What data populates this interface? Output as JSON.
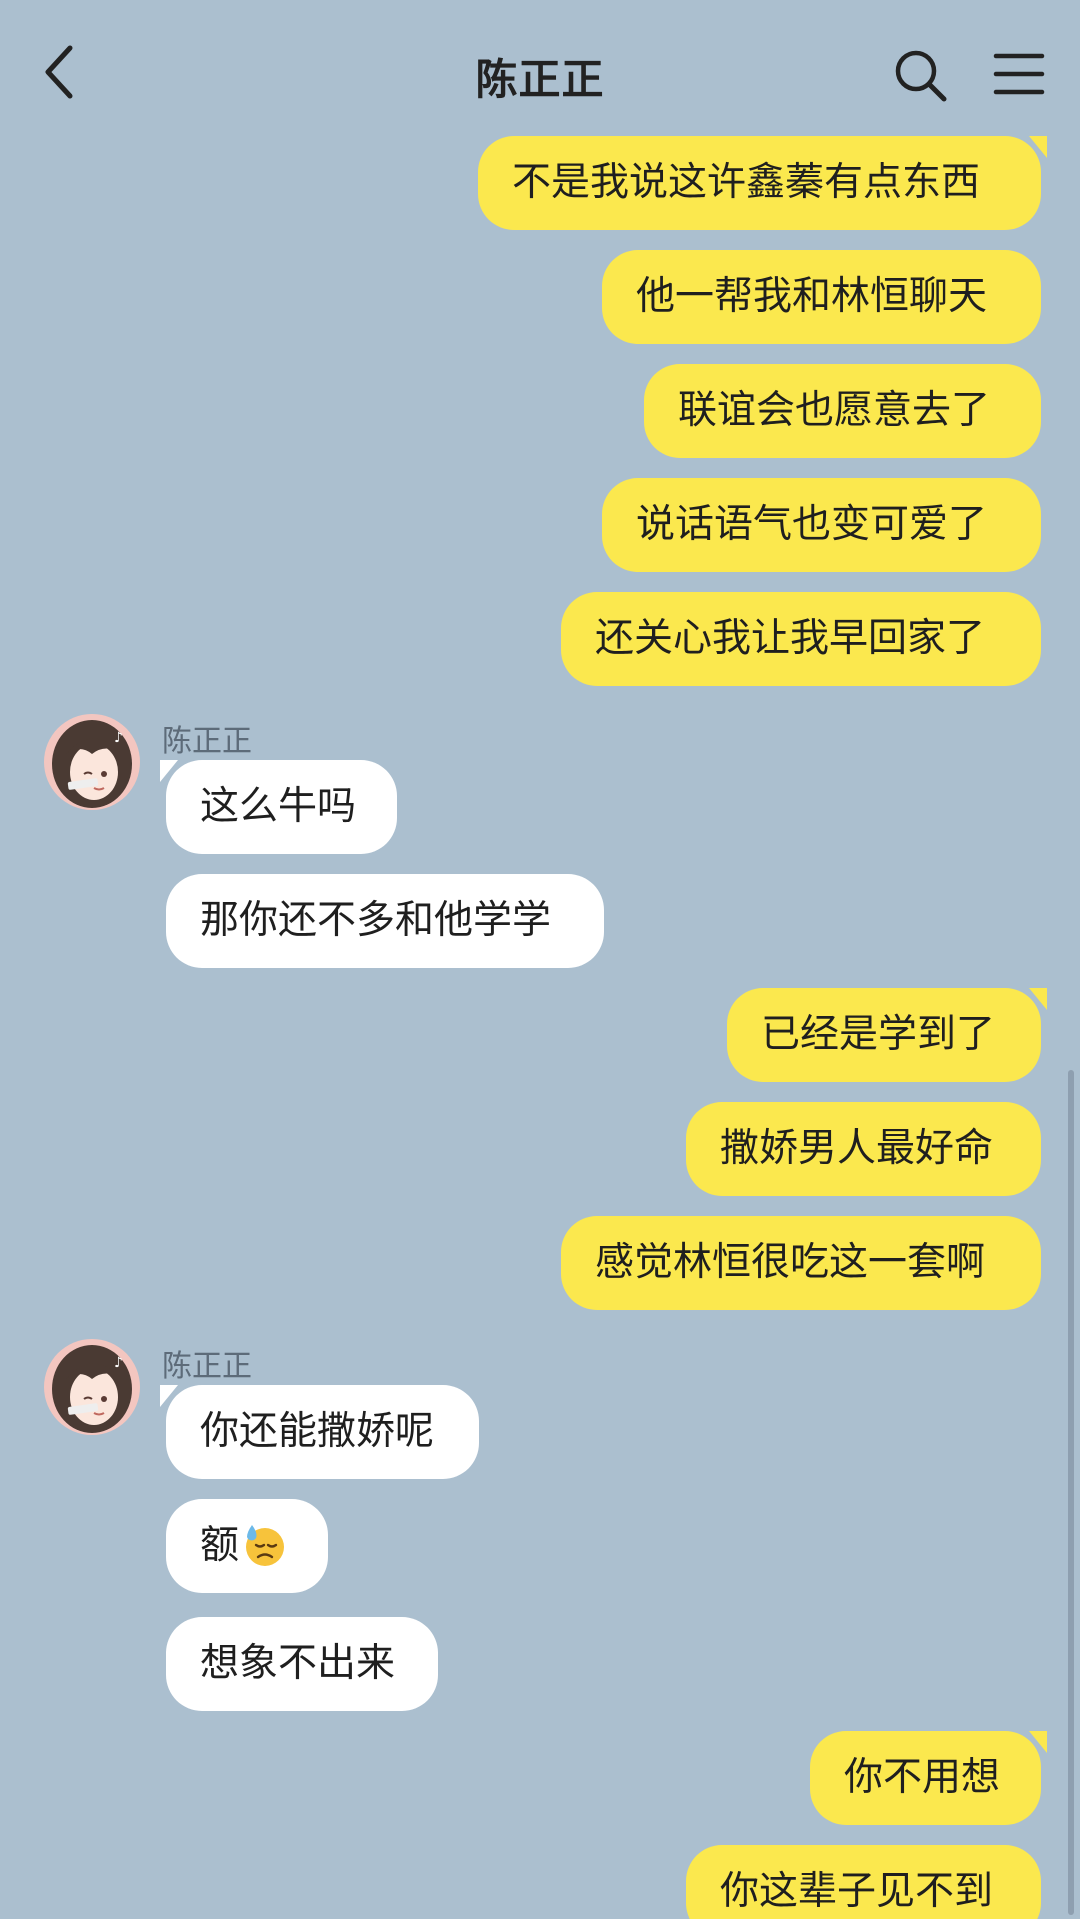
{
  "header": {
    "title": "陈正正"
  },
  "icons": {
    "back": "chevron-left-icon",
    "search": "search-icon",
    "menu": "hamburger-menu-icon"
  },
  "colors": {
    "background": "#abbfcf",
    "outgoing_bubble": "#fbe84e",
    "incoming_bubble": "#ffffff"
  },
  "messages": [
    {
      "direction": "out",
      "text": "不是我说这许鑫蓁有点东西"
    },
    {
      "direction": "out",
      "text": "他一帮我和林恒聊天"
    },
    {
      "direction": "out",
      "text": "联谊会也愿意去了"
    },
    {
      "direction": "out",
      "text": "说话语气也变可爱了"
    },
    {
      "direction": "out",
      "text": "还关心我让我早回家了"
    },
    {
      "direction": "in",
      "sender": "陈正正",
      "text": "这么牛吗"
    },
    {
      "direction": "in",
      "text": "那你还不多和他学学"
    },
    {
      "direction": "out",
      "text": "已经是学到了"
    },
    {
      "direction": "out",
      "text": "撒娇男人最好命"
    },
    {
      "direction": "out",
      "text": "感觉林恒很吃这一套啊"
    },
    {
      "direction": "in",
      "sender": "陈正正",
      "text": "你还能撒娇呢"
    },
    {
      "direction": "in",
      "text": "额",
      "emoji": "sweat-disappointed-emoji"
    },
    {
      "direction": "in",
      "text": "想象不出来"
    },
    {
      "direction": "out",
      "text": "你不用想"
    },
    {
      "direction": "out",
      "text": "你这辈子见不到"
    }
  ]
}
